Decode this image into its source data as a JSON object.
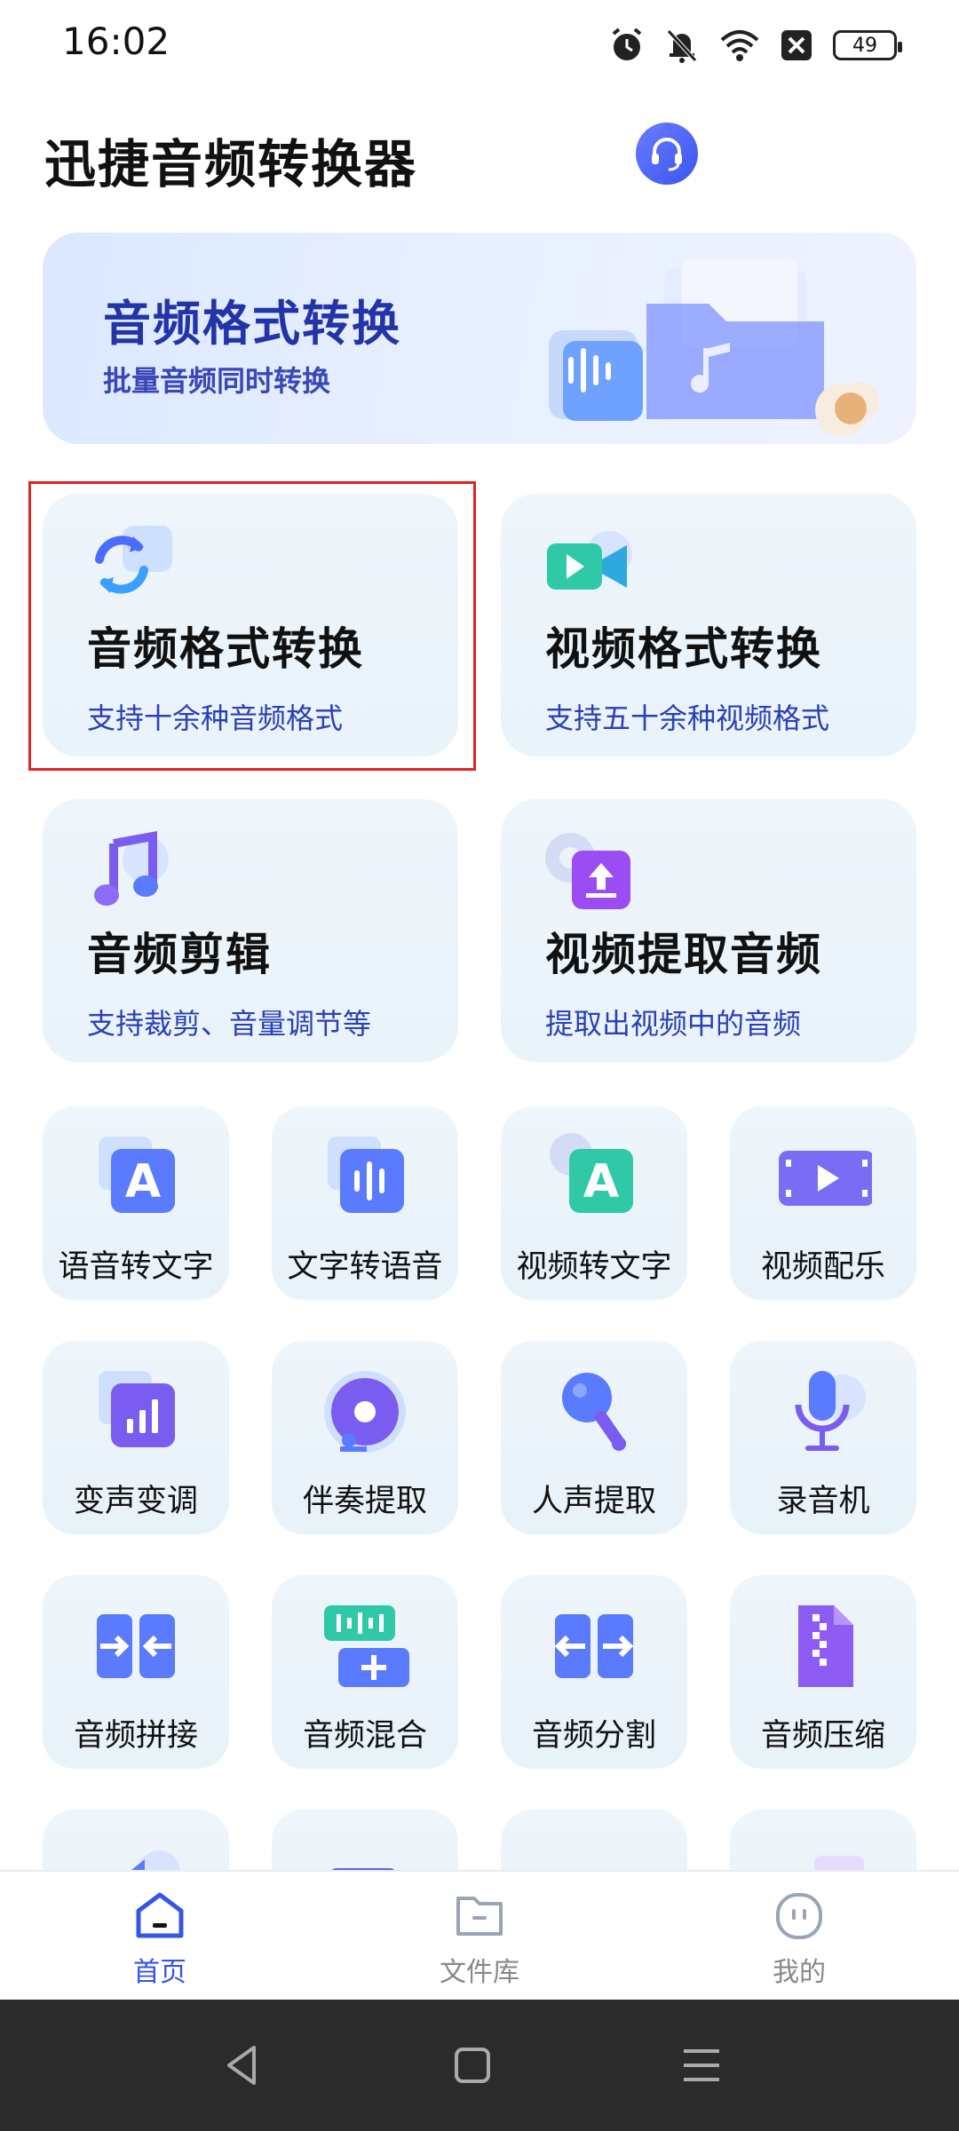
{
  "status_bar": {
    "time": "16:02",
    "battery": "49"
  },
  "header": {
    "title": "迅捷音频转换器"
  },
  "banner": {
    "title": "音频格式转换",
    "subtitle": "批量音频同时转换"
  },
  "big_cards": [
    {
      "title": "音频格式转换",
      "subtitle": "支持十余种音频格式",
      "icon": "audio-convert-icon"
    },
    {
      "title": "视频格式转换",
      "subtitle": "支持五十余种视频格式",
      "icon": "video-camera-icon"
    },
    {
      "title": "音频剪辑",
      "subtitle": "支持裁剪、音量调节等",
      "icon": "music-note-icon"
    },
    {
      "title": "视频提取音频",
      "subtitle": "提取出视频中的音频",
      "icon": "upload-icon"
    }
  ],
  "tiles": [
    {
      "label": "语音转文字",
      "icon": "letter-a-icon"
    },
    {
      "label": "文字转语音",
      "icon": "waveform-icon"
    },
    {
      "label": "视频转文字",
      "icon": "letter-a-icon"
    },
    {
      "label": "视频配乐",
      "icon": "video-play-icon"
    },
    {
      "label": "变声变调",
      "icon": "bar-chart-icon"
    },
    {
      "label": "伴奏提取",
      "icon": "disc-icon"
    },
    {
      "label": "人声提取",
      "icon": "microphone-ball-icon"
    },
    {
      "label": "录音机",
      "icon": "microphone-icon"
    },
    {
      "label": "音频拼接",
      "icon": "merge-arrows-icon"
    },
    {
      "label": "音频混合",
      "icon": "mix-plus-icon"
    },
    {
      "label": "音频分割",
      "icon": "split-arrows-icon"
    },
    {
      "label": "音频压缩",
      "icon": "zip-file-icon"
    }
  ],
  "bottom_nav": [
    {
      "label": "首页",
      "icon": "home-icon",
      "active": true
    },
    {
      "label": "文件库",
      "icon": "folder-icon",
      "active": false
    },
    {
      "label": "我的",
      "icon": "profile-icon",
      "active": false
    }
  ],
  "colors": {
    "accent": "#3554e8",
    "card_bg": "#eef5fb",
    "subtitle": "#2a3fb8",
    "highlight": "#e02424"
  }
}
